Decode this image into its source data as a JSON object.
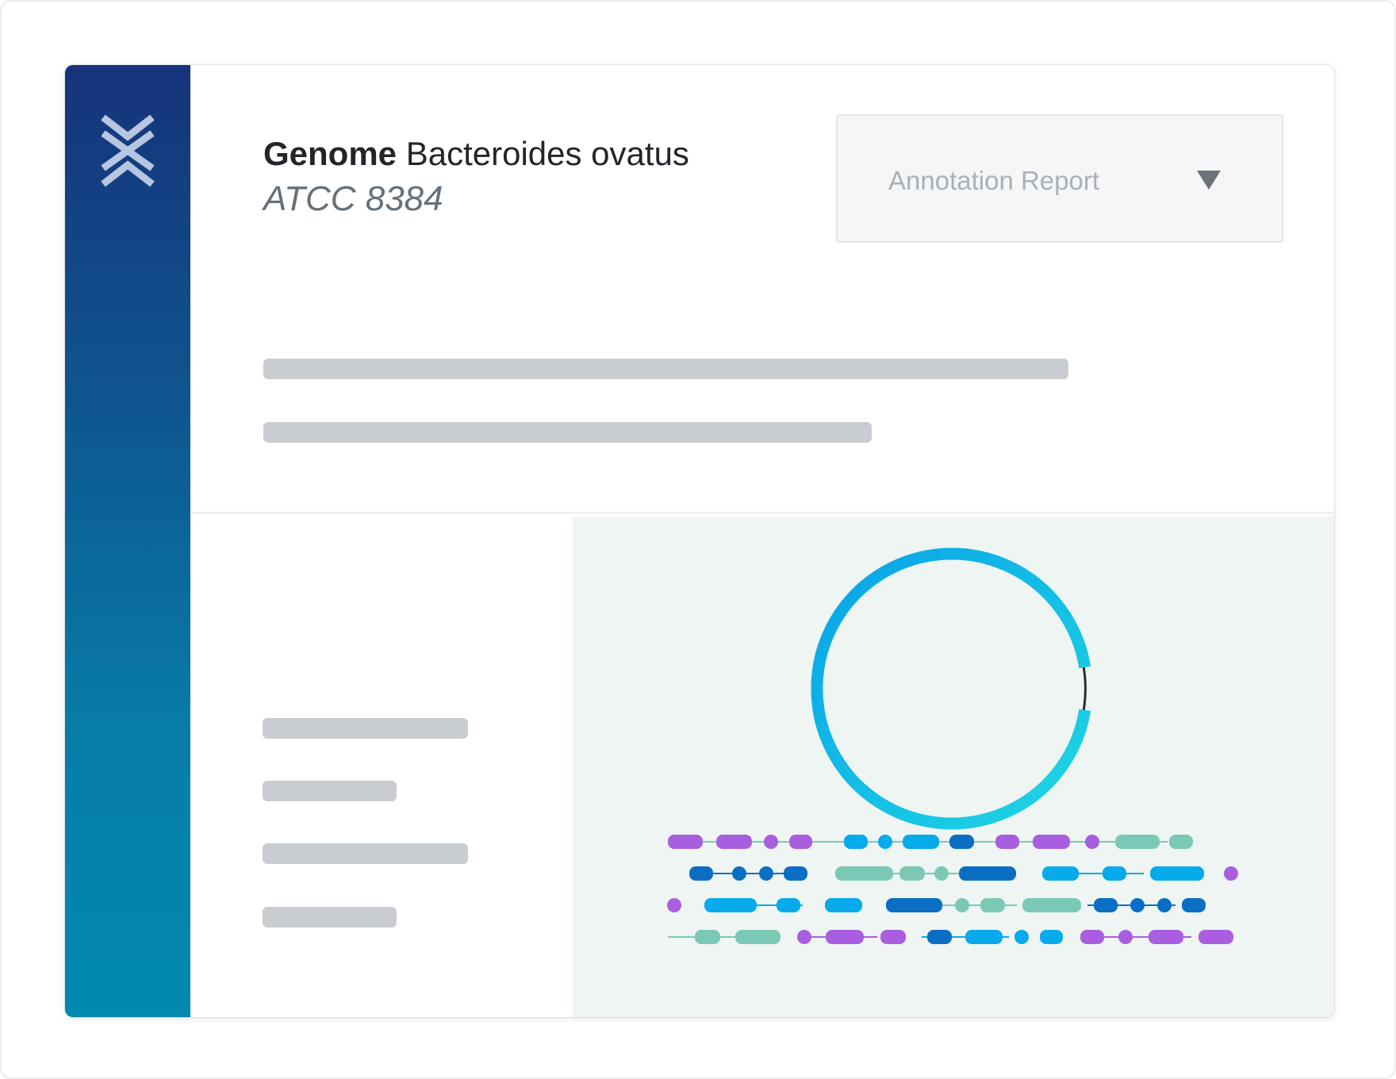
{
  "app": {
    "brand_colors": {
      "sidebar_top": "#16337a",
      "sidebar_bottom": "#0189b0",
      "ring_start": "#08a8e6",
      "ring_end": "#1ed5e2"
    }
  },
  "genome": {
    "label": "Genome",
    "name": "Bacteroides ovatus",
    "strain": "ATCC 8384"
  },
  "report_select": {
    "selected": "Annotation Report",
    "icon": "caret-down-icon"
  },
  "sidebar": {
    "logo_icon": "x-logo-icon"
  },
  "feature_palette": {
    "purple": "#a95ee0",
    "teal": "#7cc8b7",
    "cyan": "#07aaeb",
    "blue": "#0a6fc4"
  }
}
